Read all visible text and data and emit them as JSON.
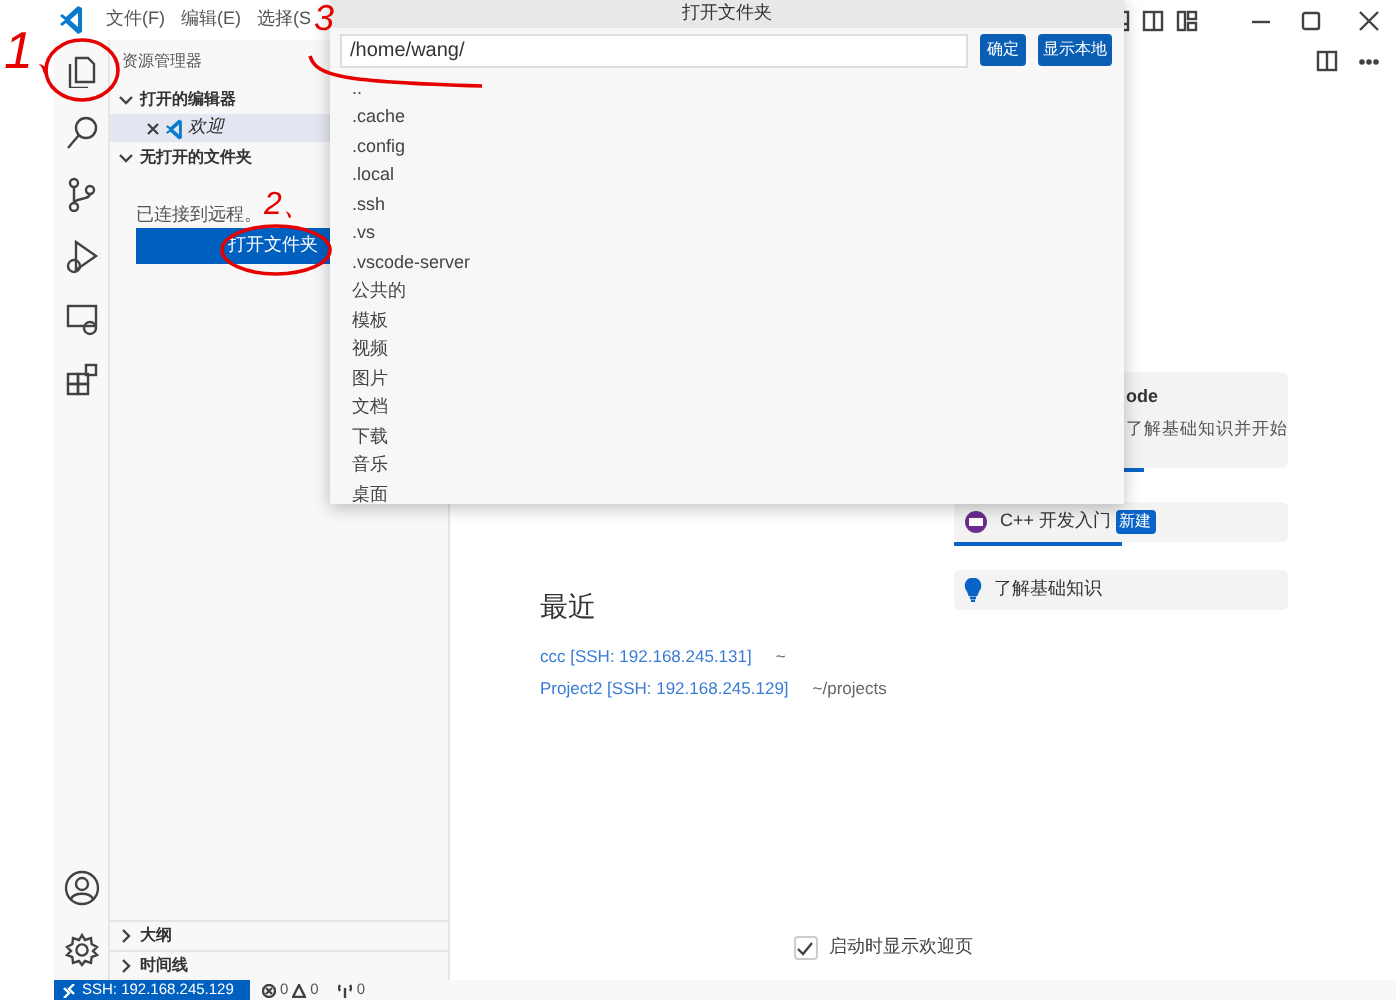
{
  "title_bar": {
    "menus": [
      "文件(F)",
      "编辑(E)",
      "选择(S"
    ]
  },
  "sidebar": {
    "title": "资源管理器",
    "sections": [
      {
        "kind": "editors",
        "title": "打开的编辑器",
        "expanded": true,
        "items": [
          {
            "label": "欢迎",
            "selected": true
          }
        ]
      },
      {
        "kind": "folder",
        "title": "无打开的文件夹",
        "expanded": true,
        "message": "已连接到远程。",
        "button": "打开文件夹"
      },
      {
        "kind": "collapsed",
        "title": "大纲",
        "expanded": false
      },
      {
        "kind": "collapsed",
        "title": "时间线",
        "expanded": false
      }
    ]
  },
  "dialog": {
    "title": "打开文件夹",
    "path": "/home/wang/",
    "buttons": [
      "确定",
      "显示本地"
    ],
    "entries": [
      "..",
      ".cache",
      ".config",
      ".local",
      ".ssh",
      ".vs",
      ".vscode-server",
      "公共的",
      "模板",
      "视频",
      "图片",
      "文档",
      "下载",
      "音乐",
      "桌面"
    ]
  },
  "welcome": {
    "walkthroughs": [
      {
        "kind": "partial",
        "title": "ode",
        "description": "了解基础知识并开始",
        "level": 0.57
      },
      {
        "kind": "cpp",
        "title": "C++ 开发入门",
        "badge": "新建",
        "level": 0.5
      },
      {
        "kind": "bulb",
        "title": "了解基础知识"
      }
    ],
    "recent_title": "最近",
    "recent": [
      {
        "name": "ccc [SSH: 192.168.245.131]",
        "path": "~"
      },
      {
        "name": "Project2 [SSH: 192.168.245.129]",
        "path": "~/projects"
      }
    ],
    "show_on_startup": {
      "label": "启动时显示欢迎页",
      "checked": true
    }
  },
  "status_bar": {
    "remote": "SSH: 192.168.245.129",
    "errors": "0",
    "warnings": "0",
    "ports": "0"
  },
  "annotations": [
    "1、",
    "2、",
    "3"
  ]
}
